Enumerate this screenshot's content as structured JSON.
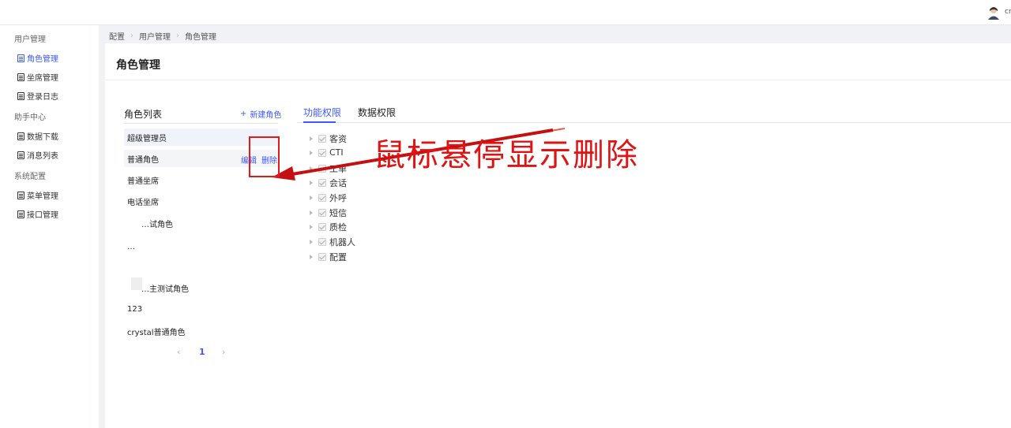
{
  "header": {
    "user_name": "cr"
  },
  "sidebar": {
    "groups": [
      {
        "label": "用户管理",
        "items": [
          {
            "label": "角色管理",
            "active": true
          },
          {
            "label": "坐席管理",
            "active": false
          },
          {
            "label": "登录日志",
            "active": false
          }
        ]
      },
      {
        "label": "助手中心",
        "items": [
          {
            "label": "数据下载",
            "active": false
          },
          {
            "label": "消息列表",
            "active": false
          }
        ]
      },
      {
        "label": "系统配置",
        "items": [
          {
            "label": "菜单管理",
            "active": false
          },
          {
            "label": "接口管理",
            "active": false
          }
        ]
      }
    ]
  },
  "breadcrumb": [
    "配置",
    "用户管理",
    "角色管理"
  ],
  "page": {
    "title": "角色管理"
  },
  "role_list": {
    "title": "角色列表",
    "new_role_label": "新建角色",
    "new_role_icon": "+",
    "roles": [
      "超级管理员",
      "普通角色",
      "普通坐席",
      "电话坐席",
      "…试角色",
      "…",
      "",
      "…主测试角色",
      "123",
      "crystal普通角色"
    ],
    "edit_label": "编辑",
    "delete_label": "删除"
  },
  "pagination": {
    "prev": "‹",
    "current": "1",
    "next": "›"
  },
  "tabs": [
    {
      "label": "功能权限",
      "active": true
    },
    {
      "label": "数据权限",
      "active": false
    }
  ],
  "permissions": [
    "客资",
    "CTI",
    "工单",
    "会话",
    "外呼",
    "短信",
    "质检",
    "机器人",
    "配置"
  ],
  "annotation": {
    "text": "鼠标悬停显示删除",
    "color": "#e31212"
  },
  "colors": {
    "accent": "#3d5afe",
    "annotation_red": "#e31212"
  }
}
